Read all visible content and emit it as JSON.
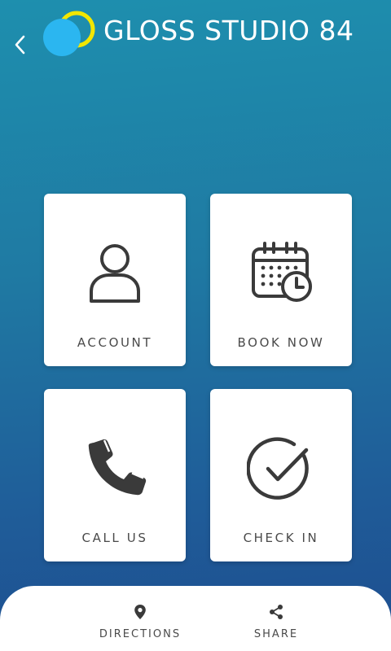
{
  "header": {
    "title": "GLOSS STUDIO 84",
    "back_icon": "chevron-left-icon",
    "logo_colors": {
      "ring": "#f2e600",
      "dot": "#2bb6f0"
    }
  },
  "tiles": [
    {
      "label": "ACCOUNT",
      "icon": "person-icon"
    },
    {
      "label": "BOOK NOW",
      "icon": "calendar-clock-icon"
    },
    {
      "label": "CALL US",
      "icon": "phone-icon"
    },
    {
      "label": "CHECK IN",
      "icon": "check-circle-icon"
    }
  ],
  "bottom_nav": {
    "items": [
      {
        "label": "DIRECTIONS",
        "icon": "location-pin-icon"
      },
      {
        "label": "SHARE",
        "icon": "share-icon"
      }
    ]
  },
  "colors": {
    "background_top": "#1e8fae",
    "background_bottom": "#1e4d8f",
    "tile_background": "#ffffff",
    "icon_color": "#3a3a3a",
    "label_color": "#4a4a4a"
  }
}
